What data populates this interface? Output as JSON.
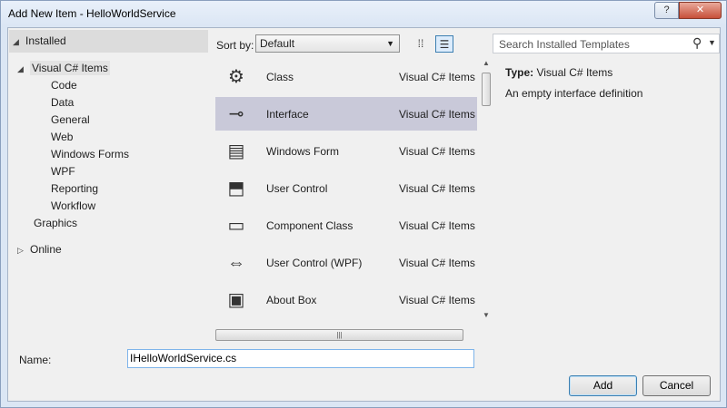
{
  "window": {
    "title": "Add New Item - HelloWorldService",
    "help_label": "?",
    "close_label": "✕"
  },
  "tree": {
    "root_label": "Installed",
    "items": [
      {
        "label": "Visual C# Items",
        "expanded": true
      },
      {
        "label": "Code"
      },
      {
        "label": "Data"
      },
      {
        "label": "General"
      },
      {
        "label": "Web"
      },
      {
        "label": "Windows Forms"
      },
      {
        "label": "WPF"
      },
      {
        "label": "Reporting"
      },
      {
        "label": "Workflow"
      },
      {
        "label": "Graphics"
      }
    ],
    "online_label": "Online"
  },
  "sort": {
    "label": "Sort by:",
    "value": "Default"
  },
  "templates": [
    {
      "name": "Class",
      "category": "Visual C# Items",
      "icon": "class-icon"
    },
    {
      "name": "Interface",
      "category": "Visual C# Items",
      "icon": "interface-icon",
      "selected": true
    },
    {
      "name": "Windows Form",
      "category": "Visual C# Items",
      "icon": "windows-form-icon"
    },
    {
      "name": "User Control",
      "category": "Visual C# Items",
      "icon": "user-control-icon"
    },
    {
      "name": "Component Class",
      "category": "Visual C# Items",
      "icon": "component-class-icon"
    },
    {
      "name": "User Control (WPF)",
      "category": "Visual C# Items",
      "icon": "user-control-wpf-icon"
    },
    {
      "name": "About Box",
      "category": "Visual C# Items",
      "icon": "about-box-icon"
    }
  ],
  "search": {
    "placeholder": "Search Installed Templates"
  },
  "details": {
    "type_label": "Type:",
    "type_value": "Visual C# Items",
    "description": "An empty interface definition"
  },
  "name_field": {
    "label": "Name:",
    "value": "IHelloWorldService.cs"
  },
  "buttons": {
    "add": "Add",
    "cancel": "Cancel"
  }
}
